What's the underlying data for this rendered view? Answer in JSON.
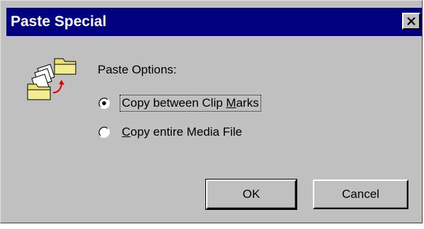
{
  "window": {
    "title": "Paste Special",
    "close_icon": "close-icon"
  },
  "dialog_icon": "paste-folder-icon",
  "paste_options": {
    "label": "Paste Options:",
    "options": [
      {
        "label_before": "Copy between Clip ",
        "mnemonic": "M",
        "label_after": "arks",
        "selected": true
      },
      {
        "label_before": "",
        "mnemonic": "C",
        "label_after": "opy entire Media File",
        "selected": false
      }
    ]
  },
  "buttons": {
    "ok": "OK",
    "cancel": "Cancel"
  }
}
